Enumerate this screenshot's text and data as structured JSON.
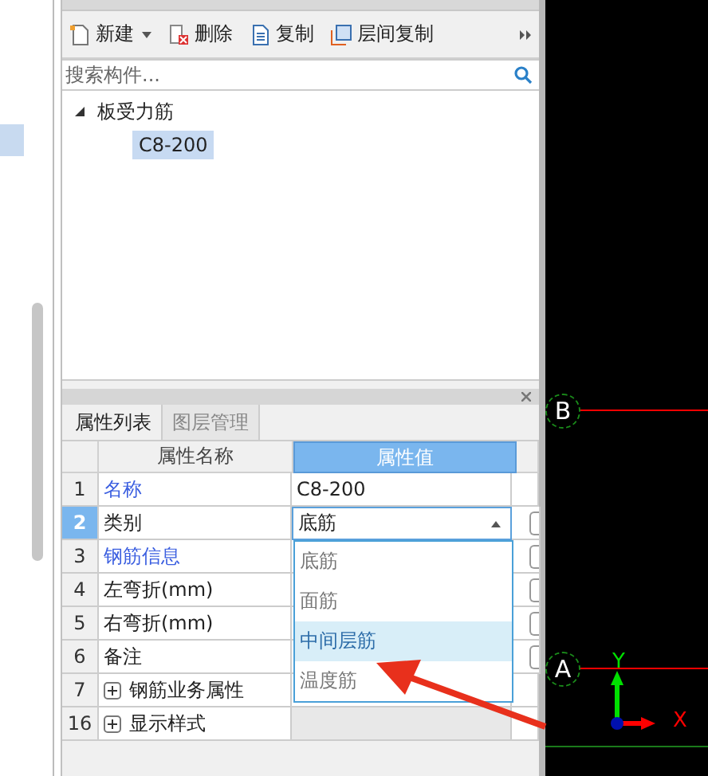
{
  "toolbar": [
    {
      "label": "新建",
      "kind": "new",
      "has_menu": true
    },
    {
      "label": "删除",
      "kind": "delete",
      "has_menu": false
    },
    {
      "label": "复制",
      "kind": "copy",
      "has_menu": false
    },
    {
      "label": "层间复制",
      "kind": "floor-copy",
      "has_menu": false
    }
  ],
  "search": {
    "placeholder": "搜索构件..."
  },
  "tree": [
    {
      "label": "板受力筋",
      "expanded": true,
      "children": [
        {
          "label": "C8-200",
          "selected": true
        }
      ]
    }
  ],
  "property_tabs": [
    {
      "label": "属性列表",
      "selected": true
    },
    {
      "label": "图层管理",
      "selected": false
    }
  ],
  "table": {
    "columns": [
      "属性名称",
      "属性值"
    ],
    "rows": [
      {
        "index": "1",
        "name": "名称",
        "value": "C8-200",
        "kind": "link",
        "selected": false
      },
      {
        "index": "2",
        "name": "类别",
        "value": "底筋",
        "kind": "dropdown",
        "selected": true,
        "checked": false
      },
      {
        "index": "3",
        "name": "钢筋信息",
        "value": "",
        "kind": "link",
        "selected": false,
        "checked": false
      },
      {
        "index": "4",
        "name": "左弯折(mm)",
        "value": "",
        "kind": "plain",
        "selected": false,
        "checked": false
      },
      {
        "index": "5",
        "name": "右弯折(mm)",
        "value": "",
        "kind": "plain",
        "selected": false,
        "checked": false
      },
      {
        "index": "6",
        "name": "备注",
        "value": "",
        "kind": "plain",
        "selected": false,
        "checked": false
      },
      {
        "index": "7",
        "name": "钢筋业务属性",
        "value": "",
        "kind": "group",
        "selected": false
      },
      {
        "index": "16",
        "name": "显示样式",
        "value": "",
        "kind": "group",
        "selected": false
      }
    ]
  },
  "dropdown": {
    "options": [
      {
        "label": "底筋",
        "highlighted": false
      },
      {
        "label": "面筋",
        "highlighted": false
      },
      {
        "label": "中间层筋",
        "highlighted": true
      },
      {
        "label": "温度筋",
        "highlighted": false
      }
    ]
  },
  "canvas": {
    "axes": [
      {
        "label": "B"
      },
      {
        "label": "A"
      }
    ],
    "ucs": {
      "x": "X",
      "y": "Y"
    }
  }
}
